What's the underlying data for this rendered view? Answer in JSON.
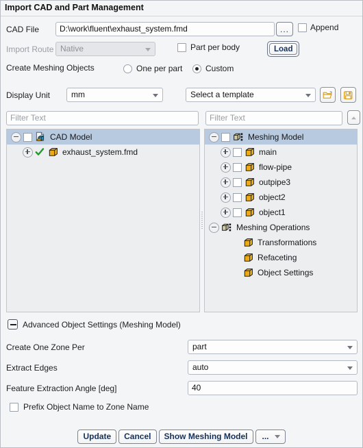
{
  "window": {
    "title": "Import CAD and Part Management"
  },
  "cad_file": {
    "label": "CAD File",
    "value": "D:\\work\\fluent\\exhaust_system.fmd",
    "browse_label": "...",
    "append_label": "Append"
  },
  "import_route": {
    "label": "Import Route",
    "value": "Native",
    "part_per_body_label": "Part per body",
    "load_label": "Load"
  },
  "create_meshing_objects": {
    "label": "Create Meshing Objects",
    "option_one_per_part": "One per part",
    "option_custom": "Custom",
    "selected": "Custom"
  },
  "display_unit": {
    "label": "Display Unit",
    "value": "mm"
  },
  "template": {
    "value": "Select a template",
    "open_icon": "open-folder-icon",
    "save_icon": "save-disk-icon"
  },
  "filters": {
    "left_placeholder": "Filter Text",
    "right_placeholder": "Filter Text",
    "collapse_icon": "chevron-up-icon"
  },
  "left_tree": {
    "nodes": [
      {
        "label": "CAD Model",
        "icon": "cad-document-icon",
        "depth": 0,
        "expander": "minus",
        "checkbox": true,
        "selected": true
      },
      {
        "label": "exhaust_system.fmd",
        "icon": "yellow-cube-icon",
        "depth": 1,
        "expander": "plus",
        "checkbox": false,
        "check_mark": true,
        "selected": false
      }
    ]
  },
  "right_tree": {
    "nodes": [
      {
        "label": "Meshing Model",
        "icon": "meshing-model-icon",
        "depth": 0,
        "expander": "minus",
        "checkbox": true,
        "selected": true
      },
      {
        "label": "main",
        "icon": "yellow-cube-icon",
        "depth": 1,
        "expander": "plus",
        "checkbox": true,
        "selected": false
      },
      {
        "label": "flow-pipe",
        "icon": "yellow-cube-icon",
        "depth": 1,
        "expander": "plus",
        "checkbox": true,
        "selected": false
      },
      {
        "label": "outpipe3",
        "icon": "yellow-cube-icon",
        "depth": 1,
        "expander": "plus",
        "checkbox": true,
        "selected": false
      },
      {
        "label": "object2",
        "icon": "yellow-cube-icon",
        "depth": 1,
        "expander": "plus",
        "checkbox": true,
        "selected": false
      },
      {
        "label": "object1",
        "icon": "yellow-cube-icon",
        "depth": 1,
        "expander": "plus",
        "checkbox": true,
        "selected": false
      },
      {
        "label": "Meshing Operations",
        "icon": "meshing-model-icon",
        "depth": 0,
        "expander": "minus",
        "checkbox": false,
        "selected": false
      },
      {
        "label": "Transformations",
        "icon": "yellow-cube-icon",
        "depth": 2,
        "expander": "none",
        "checkbox": false,
        "selected": false
      },
      {
        "label": "Refaceting",
        "icon": "yellow-cube-icon",
        "depth": 2,
        "expander": "none",
        "checkbox": false,
        "selected": false
      },
      {
        "label": "Object Settings",
        "icon": "yellow-cube-icon",
        "depth": 2,
        "expander": "none",
        "checkbox": false,
        "selected": false
      }
    ]
  },
  "advanced": {
    "section_title": "Advanced Object Settings (Meshing Model)",
    "create_one_zone_per_label": "Create One Zone Per",
    "create_one_zone_per_value": "part",
    "extract_edges_label": "Extract Edges",
    "extract_edges_value": "auto",
    "feature_angle_label": "Feature Extraction Angle [deg]",
    "feature_angle_value": "40",
    "prefix_label": "Prefix Object Name to Zone Name"
  },
  "footer": {
    "update": "Update",
    "cancel": "Cancel",
    "show_meshing_model": "Show Meshing Model",
    "more": "..."
  },
  "colors": {
    "selection": "#b8cadf",
    "cube_gold": "#f0b41e",
    "check_green": "#1d9b27",
    "button_text": "#14325c"
  }
}
